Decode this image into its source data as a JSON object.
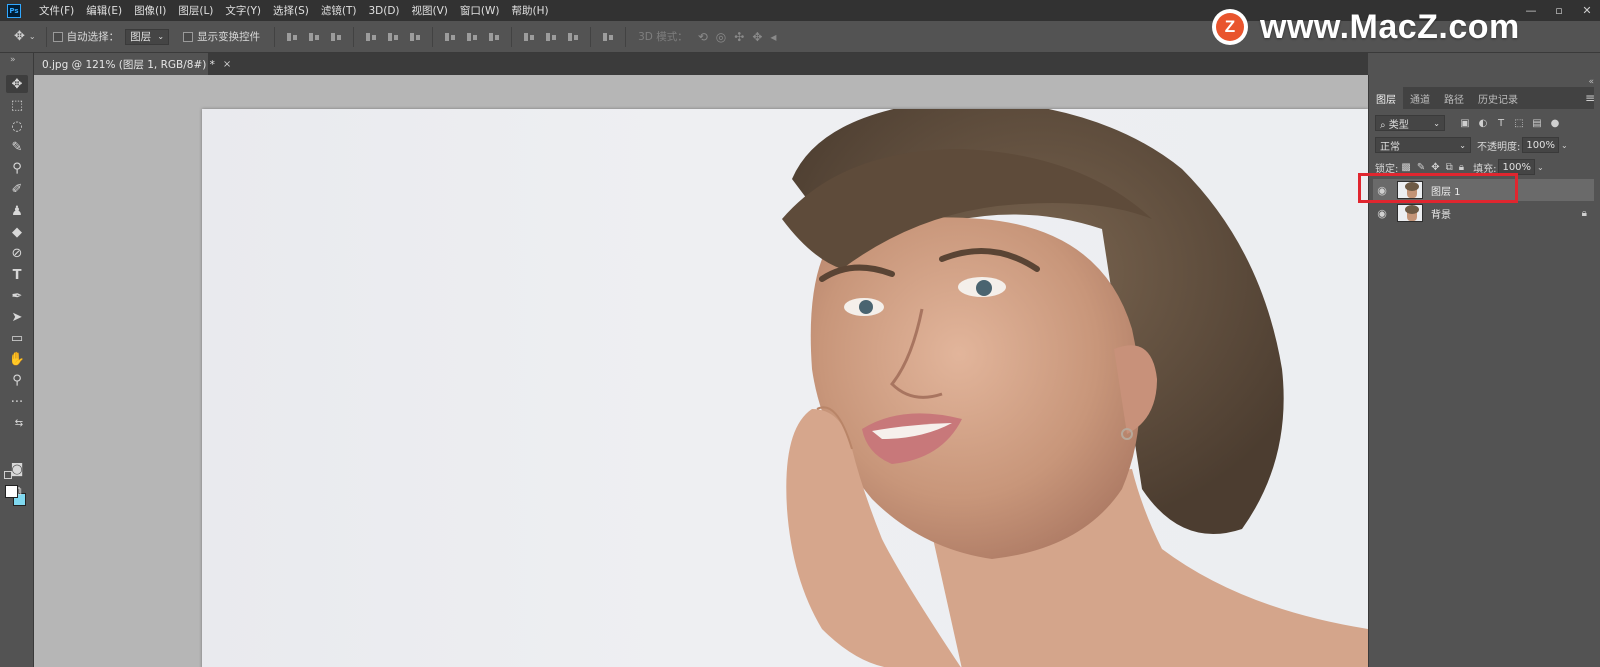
{
  "app": {
    "logo": "Ps"
  },
  "menu": [
    "文件(F)",
    "编辑(E)",
    "图像(I)",
    "图层(L)",
    "文字(Y)",
    "选择(S)",
    "滤镜(T)",
    "3D(D)",
    "视图(V)",
    "窗口(W)",
    "帮助(H)"
  ],
  "window_controls": {
    "minimize": "—",
    "restore": "▫",
    "close": "✕"
  },
  "watermark": {
    "logo_letter": "Z",
    "text": "www.MacZ.com"
  },
  "options": {
    "auto_select_label": "自动选择：",
    "auto_select_value": "图层",
    "show_transform_label": "显示变换控件",
    "mode_3d_label": "3D 模式："
  },
  "document": {
    "tab_title": "0.jpg @ 121% (图层 1, RGB/8#) *",
    "close": "×"
  },
  "toolbar": {
    "grip": "»"
  },
  "colors": {
    "foreground": "#ffffff",
    "background": "#7fd8ef",
    "highlight": "#e0262f"
  },
  "panel": {
    "collapse": "«",
    "tabs": [
      "图层",
      "通道",
      "路径",
      "历史记录"
    ],
    "active_tab": "图层",
    "menu_icon": "≡",
    "filter_kind": "类型",
    "blend_mode": "正常",
    "opacity_label": "不透明度:",
    "opacity_value": "100%",
    "lock_label": "锁定:",
    "fill_label": "填充:",
    "fill_value": "100%",
    "layers": [
      {
        "name": "图层 1",
        "visible": true,
        "selected": true,
        "locked": false
      },
      {
        "name": "背景",
        "visible": true,
        "selected": false,
        "locked": true
      }
    ]
  }
}
